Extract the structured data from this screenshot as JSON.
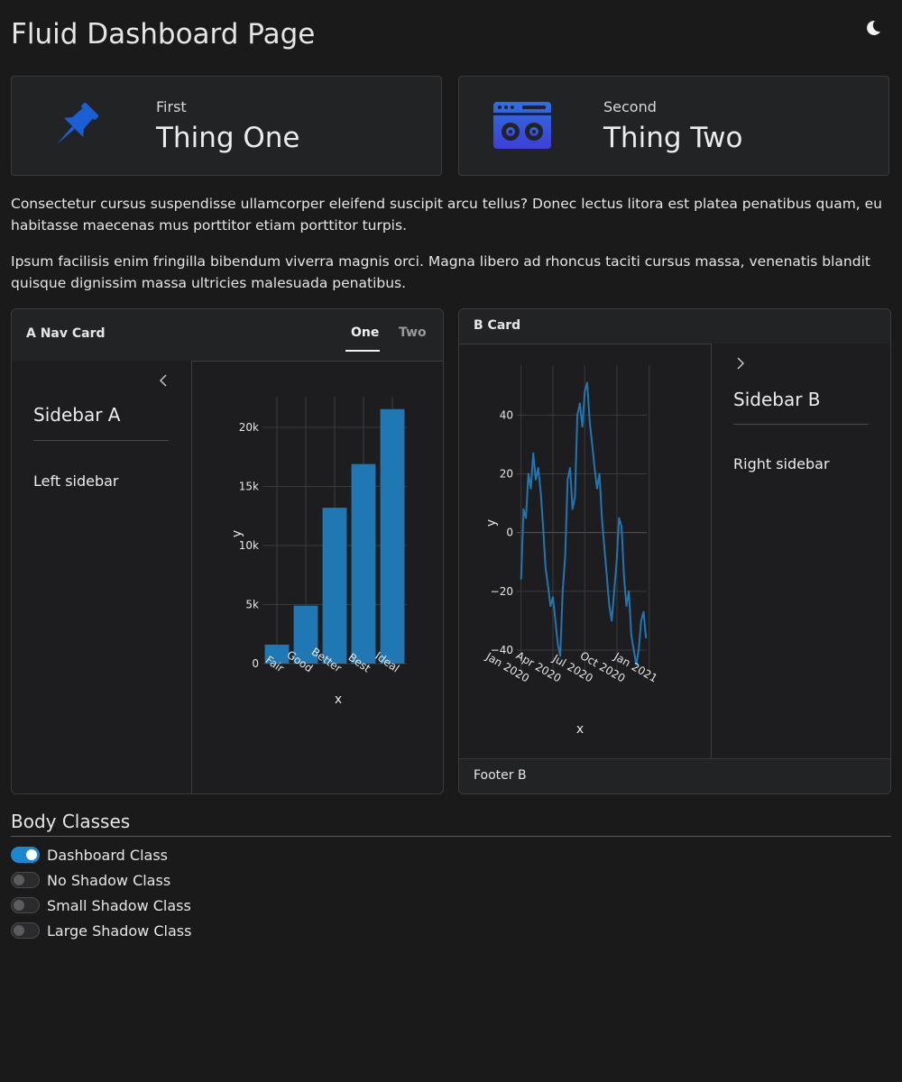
{
  "page": {
    "title": "Fluid Dashboard Page",
    "theme_icon": "moon-icon"
  },
  "value_boxes": [
    {
      "label": "First",
      "value": "Thing One",
      "icon": "pushpin-icon",
      "icon_color": "#1a5fd6"
    },
    {
      "label": "Second",
      "value": "Thing Two",
      "icon": "boombox-icon",
      "icon_color": "#2a6fe0"
    }
  ],
  "paragraphs": [
    "Consectetur cursus suspendisse ullamcorper eleifend suscipit arcu tellus? Donec lectus litora est platea penatibus quam, eu habitasse maecenas mus porttitor etiam porttitor turpis.",
    "Ipsum facilisis enim fringilla bibendum viverra magnis orci. Magna libero ad rhoncus taciti cursus massa, venenatis blandit quisque dignissim massa ultricies malesuada penatibus."
  ],
  "card_a": {
    "title": "A Nav Card",
    "tabs": [
      {
        "label": "One",
        "active": true
      },
      {
        "label": "Two",
        "active": false
      }
    ],
    "sidebar": {
      "title": "Sidebar A",
      "text": "Left sidebar",
      "collapse_icon": "chevron-left-icon"
    }
  },
  "card_b": {
    "title": "B Card",
    "footer": "Footer B",
    "sidebar": {
      "title": "Sidebar B",
      "text": "Right sidebar",
      "collapse_icon": "chevron-right-icon"
    }
  },
  "body_classes": {
    "title": "Body Classes",
    "switches": [
      {
        "label": "Dashboard Class",
        "checked": true
      },
      {
        "label": "No Shadow Class",
        "checked": false
      },
      {
        "label": "Small Shadow Class",
        "checked": false
      },
      {
        "label": "Large Shadow Class",
        "checked": false
      }
    ]
  },
  "colors": {
    "background": "#1a1a1a",
    "series": "#1f77b4",
    "switch_on": "#1c86d1"
  },
  "chart_data": [
    {
      "type": "bar",
      "categories": [
        "Fair",
        "Good",
        "Better",
        "Best",
        "Ideal"
      ],
      "values": [
        1610,
        4906,
        13200,
        16900,
        21551
      ],
      "xlabel": "x",
      "ylabel": "y",
      "ylim": [
        0,
        22600
      ],
      "yticks": [
        0,
        5000,
        10000,
        15000,
        20000
      ],
      "ytick_labels": [
        "0",
        "5k",
        "10k",
        "15k",
        "20k"
      ],
      "grid": true,
      "legend": "none"
    },
    {
      "type": "line",
      "xlabel": "x",
      "ylabel": "y",
      "xlim": [
        "2019-12-20",
        "2020-12-25"
      ],
      "xticks": [
        "2020-01-01",
        "2020-04-01",
        "2020-07-01",
        "2020-10-01",
        "2021-01-01"
      ],
      "xtick_labels": [
        "Jan 2020",
        "Apr 2020",
        "Jul 2020",
        "Oct 2020",
        "Jan 2021"
      ],
      "ylim": [
        -48,
        57
      ],
      "yticks": [
        -40,
        -20,
        0,
        20,
        40
      ],
      "ytick_labels": [
        "−40",
        "−20",
        "0",
        "20",
        "40"
      ],
      "grid": true,
      "legend": "none",
      "series": [
        {
          "x": [
            "2020-01-01",
            "2020-01-08",
            "2020-01-15",
            "2020-01-22",
            "2020-01-29",
            "2020-02-05",
            "2020-02-12",
            "2020-02-19",
            "2020-02-26",
            "2020-03-04",
            "2020-03-11",
            "2020-03-18",
            "2020-03-25",
            "2020-04-01",
            "2020-04-08",
            "2020-04-15",
            "2020-04-22",
            "2020-04-29",
            "2020-05-06",
            "2020-05-13",
            "2020-05-20",
            "2020-05-27",
            "2020-06-03",
            "2020-06-10",
            "2020-06-17",
            "2020-06-24",
            "2020-07-01",
            "2020-07-08",
            "2020-07-15",
            "2020-07-22",
            "2020-07-29",
            "2020-08-05",
            "2020-08-12",
            "2020-08-19",
            "2020-08-26",
            "2020-09-02",
            "2020-09-09",
            "2020-09-16",
            "2020-09-23",
            "2020-09-30",
            "2020-10-07",
            "2020-10-14",
            "2020-10-21",
            "2020-10-28",
            "2020-11-04",
            "2020-11-11",
            "2020-11-18",
            "2020-11-25",
            "2020-12-02",
            "2020-12-09",
            "2020-12-16",
            "2020-12-23"
          ],
          "y": [
            -16,
            8,
            5,
            20,
            15,
            27,
            18,
            22,
            14,
            2,
            -12,
            -18,
            -25,
            -22,
            -30,
            -38,
            -42,
            -20,
            -8,
            18,
            22,
            8,
            12,
            40,
            44,
            36,
            48,
            51,
            38,
            30,
            22,
            15,
            20,
            5,
            -5,
            -15,
            -25,
            -30,
            -20,
            -10,
            5,
            2,
            -15,
            -25,
            -20,
            -35,
            -40,
            -45,
            -40,
            -30,
            -27,
            -36
          ]
        }
      ]
    }
  ]
}
